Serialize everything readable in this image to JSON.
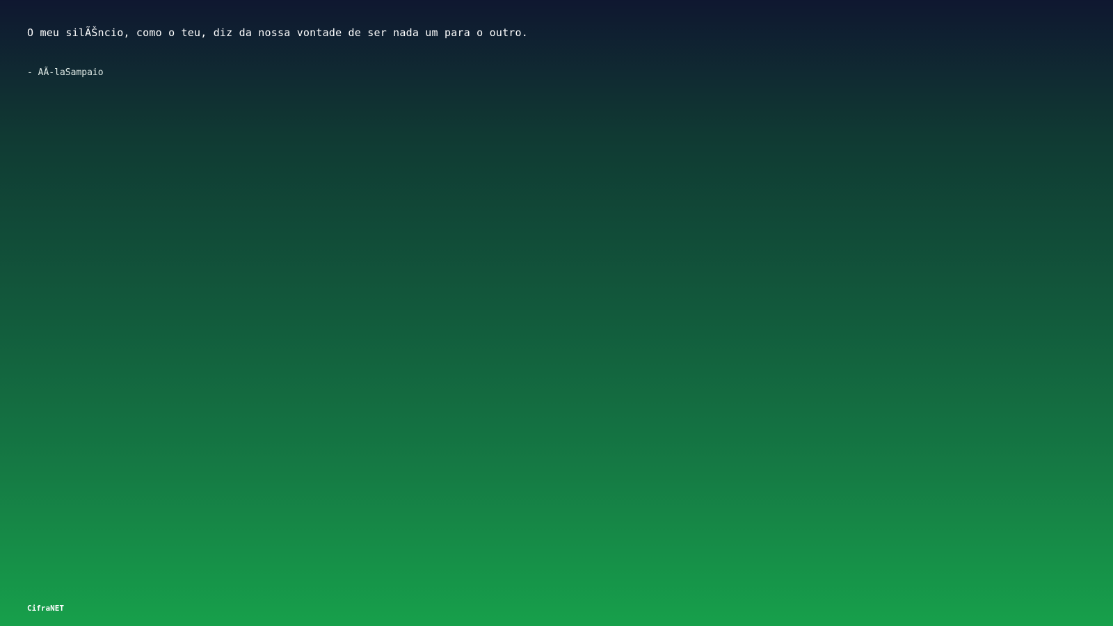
{
  "quote": {
    "text": "O meu silÃŠncio, como o teu, diz da nossa vontade de ser nada um para o outro.",
    "author": "- AÃ-laSampaio"
  },
  "footer": {
    "brand": "CifraNET"
  },
  "colors": {
    "gradient_top": "#0f1730",
    "gradient_bottom": "#17a04b",
    "text": "#ffffff"
  }
}
